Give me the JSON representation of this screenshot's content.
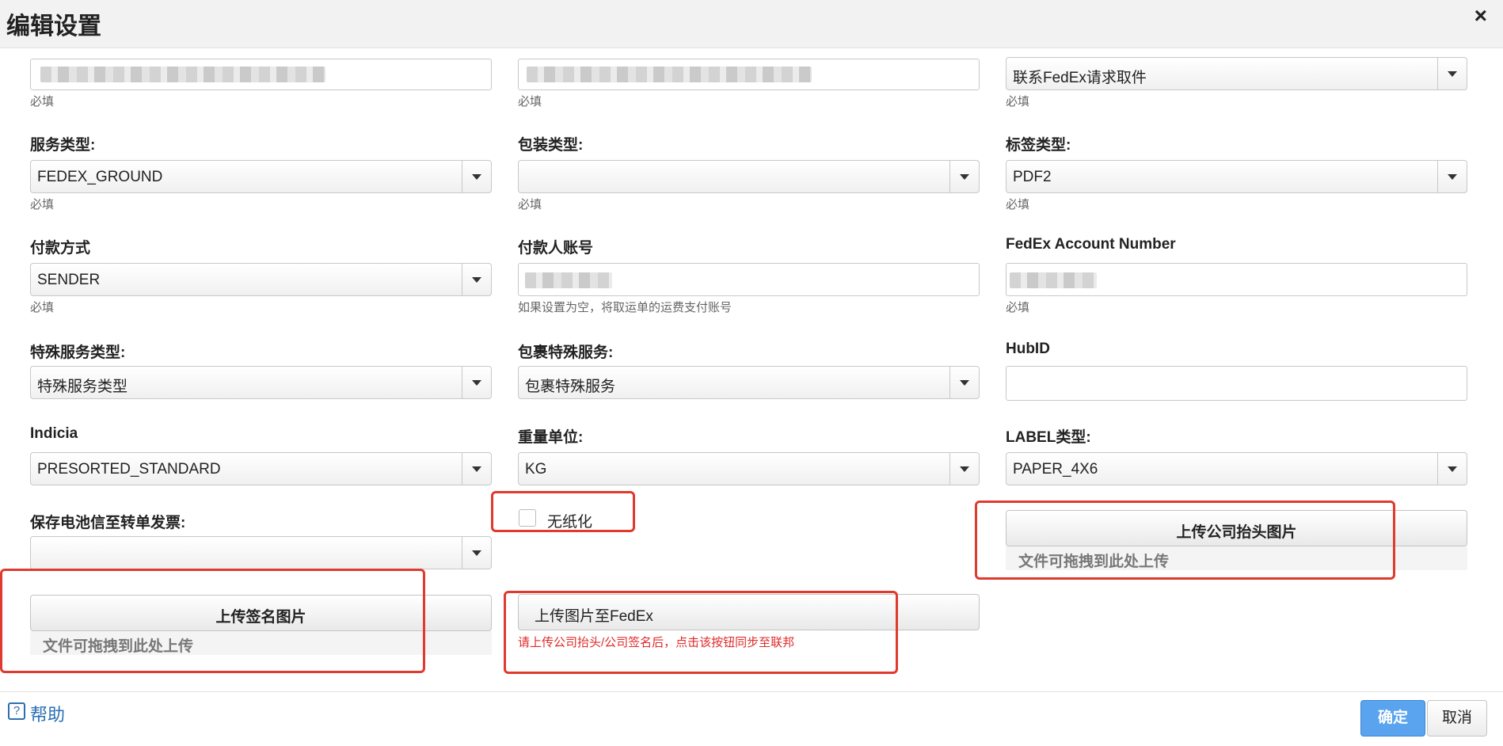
{
  "dialog": {
    "title": "编辑设置",
    "close_icon": "×"
  },
  "row1": {
    "col1": {
      "hint": "必填"
    },
    "col2": {
      "hint": "必填"
    },
    "col3": {
      "value": "联系FedEx请求取件",
      "hint": "必填"
    }
  },
  "service_type": {
    "label": "服务类型:",
    "value": "FEDEX_GROUND",
    "hint": "必填"
  },
  "packaging_type": {
    "label": "包装类型:",
    "value": "",
    "hint": "必填"
  },
  "label_type": {
    "label": "标签类型:",
    "value": "PDF2",
    "hint": "必填"
  },
  "payment_method": {
    "label": "付款方式",
    "value": "SENDER",
    "hint": "必填"
  },
  "payer_account": {
    "label": "付款人账号",
    "hint": "如果设置为空，将取运单的运费支付账号"
  },
  "fedex_account": {
    "label": "FedEx Account Number",
    "hint": "必填"
  },
  "special_service": {
    "label": "特殊服务类型:",
    "value": "特殊服务类型"
  },
  "package_special_service": {
    "label": "包裹特殊服务:",
    "value": "包裹特殊服务"
  },
  "hub_id": {
    "label": "HubID",
    "value": ""
  },
  "indicia": {
    "label": "Indicia",
    "value": "PRESORTED_STANDARD"
  },
  "weight_unit": {
    "label": "重量单位:",
    "value": "KG"
  },
  "label_stock": {
    "label": "LABEL类型:",
    "value": "PAPER_4X6"
  },
  "battery": {
    "label": "保存电池信至转单发票:",
    "value": ""
  },
  "paperless": {
    "label": "无纸化",
    "checked": false
  },
  "letterhead": {
    "button": "上传公司抬头图片",
    "drop_hint": "文件可拖拽到此处上传"
  },
  "signature": {
    "button": "上传签名图片",
    "drop_hint": "文件可拖拽到此处上传"
  },
  "upload_fedex": {
    "button": "上传图片至FedEx",
    "note": "请上传公司抬头/公司签名后，点击该按钮同步至联邦"
  },
  "footer": {
    "help_icon": "?",
    "help": "帮助",
    "ok": "确定",
    "cancel": "取消"
  },
  "colors": {
    "accent": "#5aa3ee",
    "link": "#2a6fb5",
    "highlight": "#e03a2e",
    "note": "#e02a2a"
  }
}
